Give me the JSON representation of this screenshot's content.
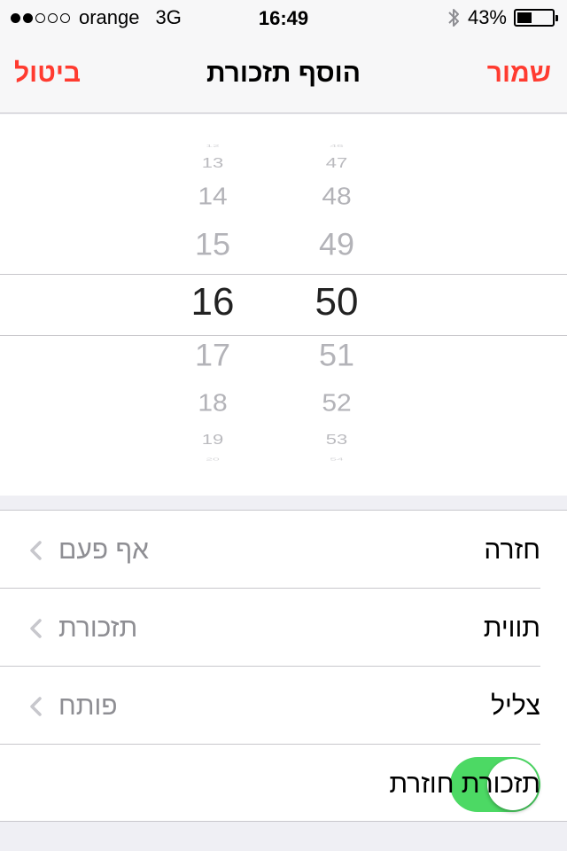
{
  "status_bar": {
    "carrier": "orange",
    "network": "3G",
    "time": "16:49",
    "battery_percent": "43%",
    "battery_level": 0.43,
    "signal_bars_filled": 2,
    "signal_bars_total": 5
  },
  "nav": {
    "title": "הוסף תזכורת",
    "cancel_label": "ביטול",
    "save_label": "שמור"
  },
  "picker": {
    "hours": [
      "12",
      "13",
      "14",
      "15",
      "16",
      "17",
      "18",
      "19",
      "20"
    ],
    "minutes": [
      "46",
      "47",
      "48",
      "49",
      "50",
      "51",
      "52",
      "53",
      "54"
    ],
    "selected_hour": "16",
    "selected_minute": "50"
  },
  "settings": {
    "repeat": {
      "label": "חזרה",
      "value": "אף פעם"
    },
    "label": {
      "label": "תווית",
      "value": "תזכורת"
    },
    "sound": {
      "label": "צליל",
      "value": "פותח"
    },
    "snooze": {
      "label": "תזכורת חוזרת",
      "enabled": true
    }
  },
  "colors": {
    "accent": "#ff3b30",
    "toggle_on": "#4cd964",
    "secondary_text": "#8e8e93",
    "separator": "#c8c7cc",
    "background": "#efeff4"
  }
}
